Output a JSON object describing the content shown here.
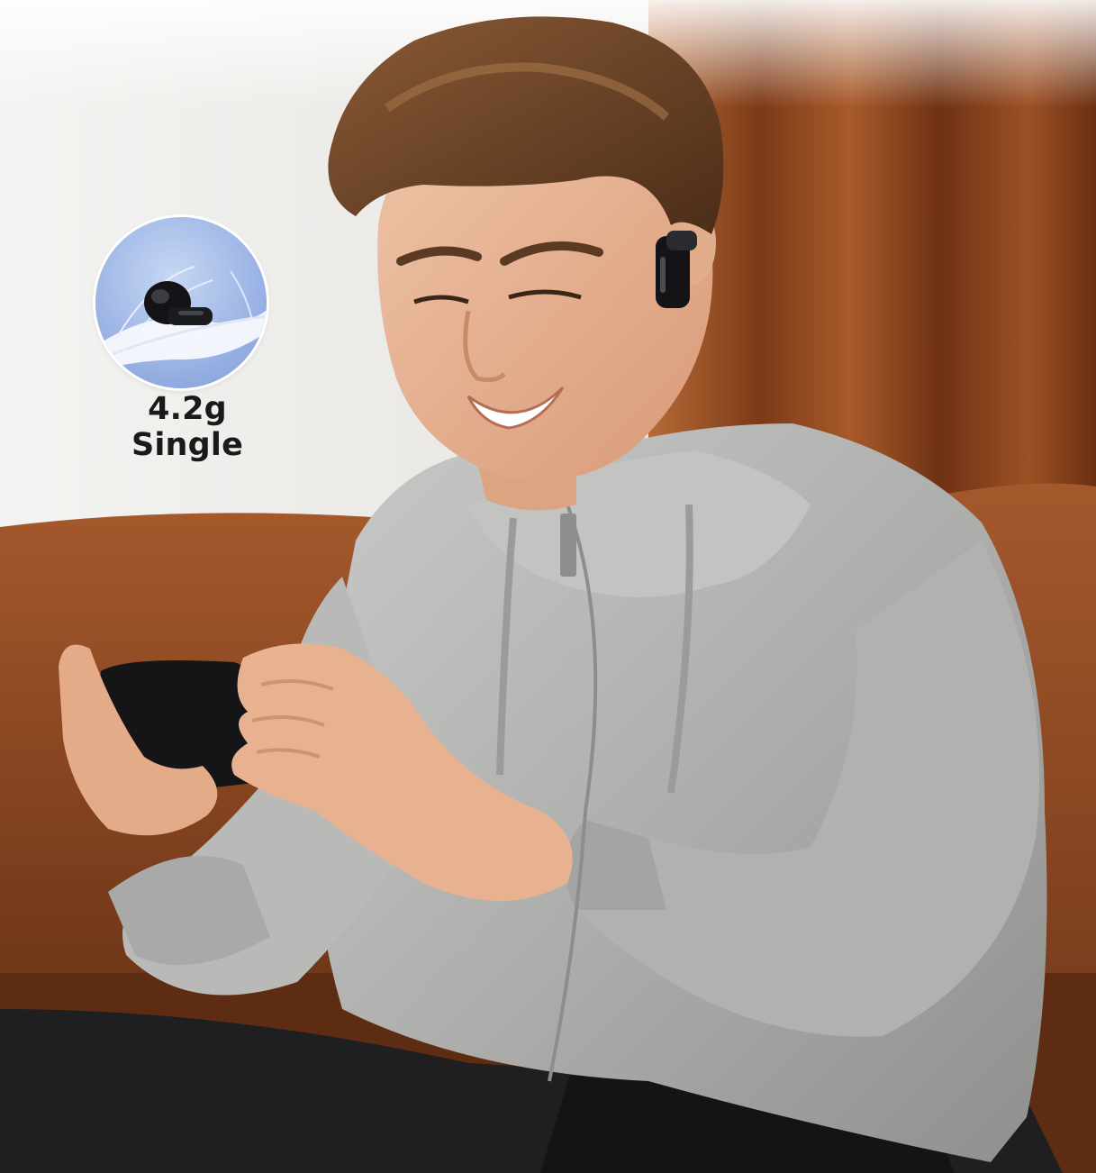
{
  "badge": {
    "label": "4.2g Single",
    "icon": "earbud-on-feather-icon"
  },
  "colors": {
    "badge_bg": "#9eb6e6",
    "wall": "#eeede9",
    "curtain": "#8a4420",
    "sofa": "#8e4a25",
    "jacket": "#b4b5b3",
    "trousers": "#1f1f22"
  }
}
